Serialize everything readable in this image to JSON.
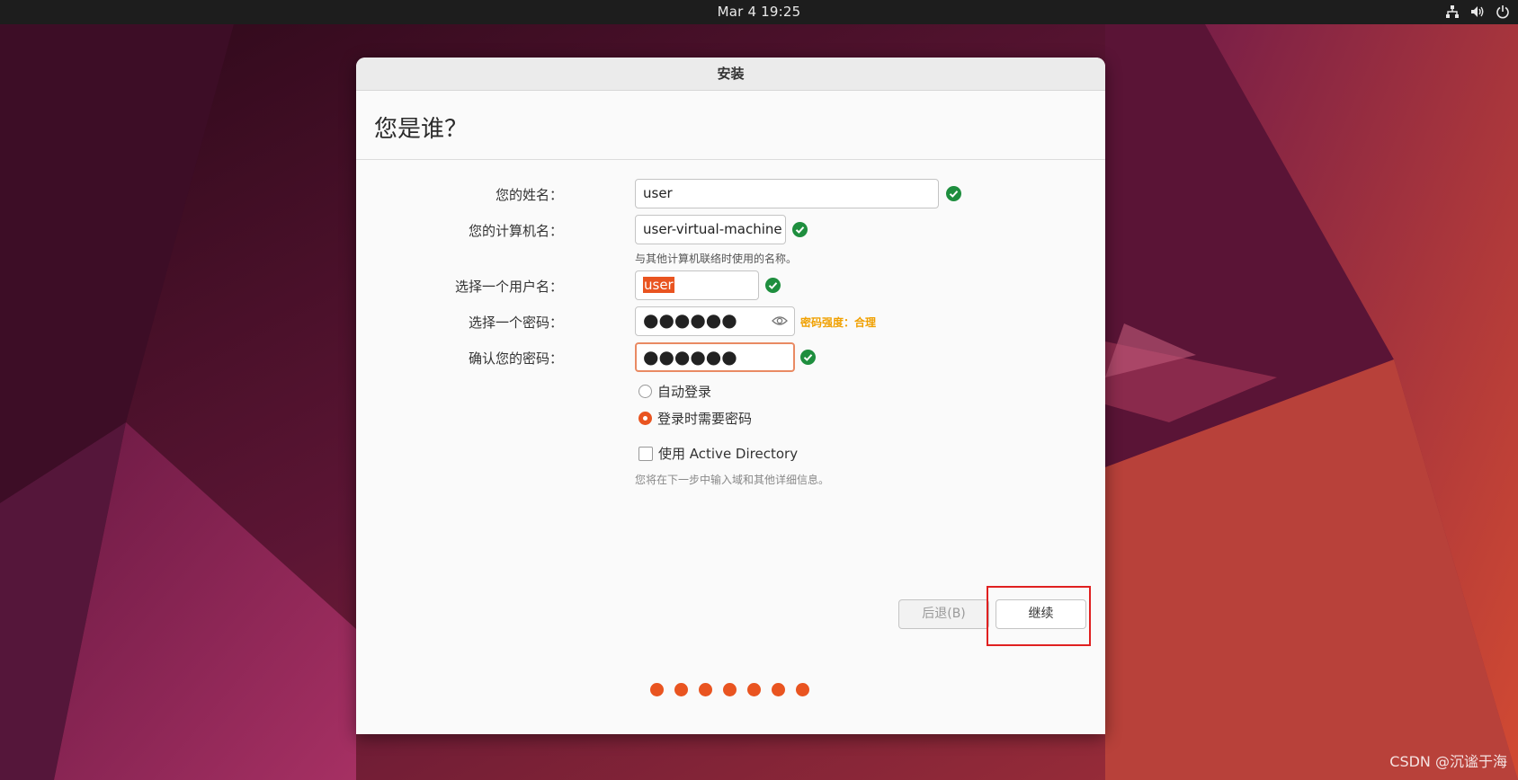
{
  "topbar": {
    "clock": "Mar 4  19:25",
    "tray_icons": [
      "network-icon",
      "volume-icon",
      "power-icon"
    ]
  },
  "window": {
    "title": "安装",
    "heading": "您是谁？"
  },
  "form": {
    "name_label": "您的姓名：",
    "name_value": "user",
    "computer_label": "您的计算机名：",
    "computer_value": "user-virtual-machine",
    "computer_hint": "与其他计算机联络时使用的名称。",
    "username_label": "选择一个用户名：",
    "username_value": "user",
    "password_label": "选择一个密码：",
    "password_value": "●●●●●●",
    "password_strength": "密码强度：合理",
    "confirm_label": "确认您的密码：",
    "confirm_value": "●●●●●●",
    "auto_login_label": "自动登录",
    "require_password_label": "登录时需要密码",
    "active_directory_label": "使用 Active Directory",
    "active_directory_hint": "您将在下一步中输入域和其他详细信息。"
  },
  "buttons": {
    "back_label": "后退(B)",
    "continue_label": "继续"
  },
  "progress": {
    "total_steps": 7,
    "current_step": 7
  },
  "watermark": "CSDN @沉谧于海",
  "colors": {
    "accent": "#E95420",
    "check_green": "#1E8E3E",
    "strength_text": "#F0A000",
    "highlight_box": "#E02020"
  }
}
